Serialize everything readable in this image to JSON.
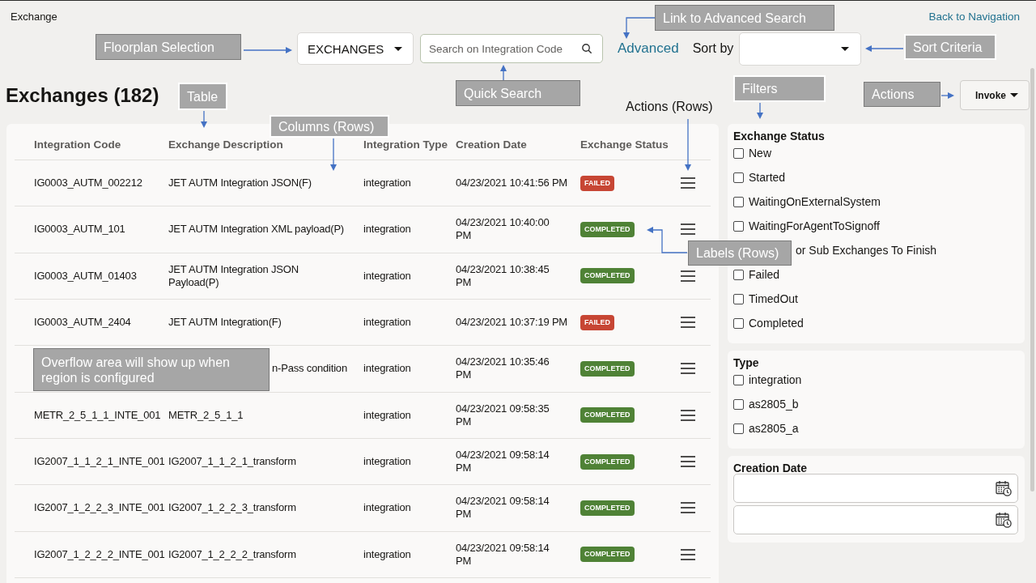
{
  "header": {
    "title": "Exchange",
    "back_link": "Back to Navigation"
  },
  "toolbar": {
    "floorplan": {
      "value": "EXCHANGES"
    },
    "search": {
      "placeholder": "Search on Integration Code"
    },
    "advanced_link": "Advanced",
    "sort": {
      "label": "Sort by"
    }
  },
  "page_title": "Exchanges (182)",
  "actions_button": {
    "label": "Invoke"
  },
  "table": {
    "columns": [
      "Integration Code",
      "Exchange Description",
      "Integration Type",
      "Creation Date",
      "Exchange Status"
    ],
    "rows": [
      {
        "integration_code": "IG0003_AUTM_002212",
        "exchange_description": "JET AUTM Integration JSON(F)",
        "integration_type": "integration",
        "creation_date": "04/23/2021 10:41:56 PM",
        "status": {
          "label": "FAILED",
          "color": "#c74634"
        }
      },
      {
        "integration_code": "IG0003_AUTM_101",
        "exchange_description": "JET AUTM Integration XML payload(P)",
        "integration_type": "integration",
        "creation_date": "04/23/2021 10:40:00 PM",
        "status": {
          "label": "COMPLETED",
          "color": "#4f8236"
        }
      },
      {
        "integration_code": "IG0003_AUTM_01403",
        "exchange_description": "JET AUTM Integration JSON Payload(P)",
        "integration_type": "integration",
        "creation_date": "04/23/2021 10:38:45 PM",
        "status": {
          "label": "COMPLETED",
          "color": "#4f8236"
        }
      },
      {
        "integration_code": "IG0003_AUTM_2404",
        "exchange_description": "JET AUTM Integration(F)",
        "integration_type": "integration",
        "creation_date": "04/23/2021 10:37:19 PM",
        "status": {
          "label": "FAILED",
          "color": "#c74634"
        }
      },
      {
        "exchange_description": "n-Pass condition",
        "integration_type": "integration",
        "creation_date": "04/23/2021 10:35:46 PM",
        "status": {
          "label": "COMPLETED",
          "color": "#4f8236"
        }
      },
      {
        "integration_code": "METR_2_5_1_1_INTE_001",
        "exchange_description": "METR_2_5_1_1",
        "integration_type": "integration",
        "creation_date": "04/23/2021 09:58:35 PM",
        "status": {
          "label": "COMPLETED",
          "color": "#4f8236"
        }
      },
      {
        "integration_code": "IG2007_1_1_2_1_INTE_001",
        "exchange_description": "IG2007_1_1_2_1_transform",
        "integration_type": "integration",
        "creation_date": "04/23/2021 09:58:14 PM",
        "status": {
          "label": "COMPLETED",
          "color": "#4f8236"
        }
      },
      {
        "integration_code": "IG2007_1_2_2_3_INTE_001",
        "exchange_description": "IG2007_1_2_2_3_transform",
        "integration_type": "integration",
        "creation_date": "04/23/2021 09:58:14 PM",
        "status": {
          "label": "COMPLETED",
          "color": "#4f8236"
        }
      },
      {
        "integration_code": "IG2007_1_2_2_2_INTE_001",
        "exchange_description": "IG2007_1_2_2_2_transform",
        "integration_type": "integration",
        "creation_date": "04/23/2021 09:58:14 PM",
        "status": {
          "label": "COMPLETED",
          "color": "#4f8236"
        }
      }
    ]
  },
  "filters": [
    {
      "kind": "checklist",
      "title": "Exchange Status",
      "options": [
        {
          "label": "New",
          "checked": false
        },
        {
          "label": "Started",
          "checked": false
        },
        {
          "label": "WaitingOnExternalSystem",
          "checked": false
        },
        {
          "label": "WaitingForAgentToSignoff",
          "checked": false
        },
        {
          "label": "or Sub Exchanges To Finish"
        },
        {
          "label": "Failed",
          "checked": false
        },
        {
          "label": "TimedOut",
          "checked": false
        },
        {
          "label": "Completed",
          "checked": false
        }
      ]
    },
    {
      "kind": "checklist",
      "title": "Type",
      "options": [
        {
          "label": "integration",
          "checked": false
        },
        {
          "label": "as2805_b",
          "checked": false
        },
        {
          "label": "as2805_a",
          "checked": false
        }
      ]
    },
    {
      "kind": "date_range",
      "title": "Creation Date"
    }
  ],
  "annotations": [
    {
      "text": "Link to Advanced Search",
      "kind": "box"
    },
    {
      "text": "Floorplan Selection",
      "kind": "box"
    },
    {
      "text": "Sort Criteria",
      "kind": "box"
    },
    {
      "text": "Table",
      "kind": "box"
    },
    {
      "text": "Quick Search",
      "kind": "box"
    },
    {
      "text": "Actions (Rows)",
      "kind": "plain"
    },
    {
      "text": "Filters",
      "kind": "box"
    },
    {
      "text": "Actions",
      "kind": "box"
    },
    {
      "text": "Columns (Rows)",
      "kind": "box"
    },
    {
      "text": "Labels (Rows)",
      "kind": "box"
    },
    {
      "text": "Overflow area will show up when region is configured",
      "kind": "box"
    }
  ]
}
